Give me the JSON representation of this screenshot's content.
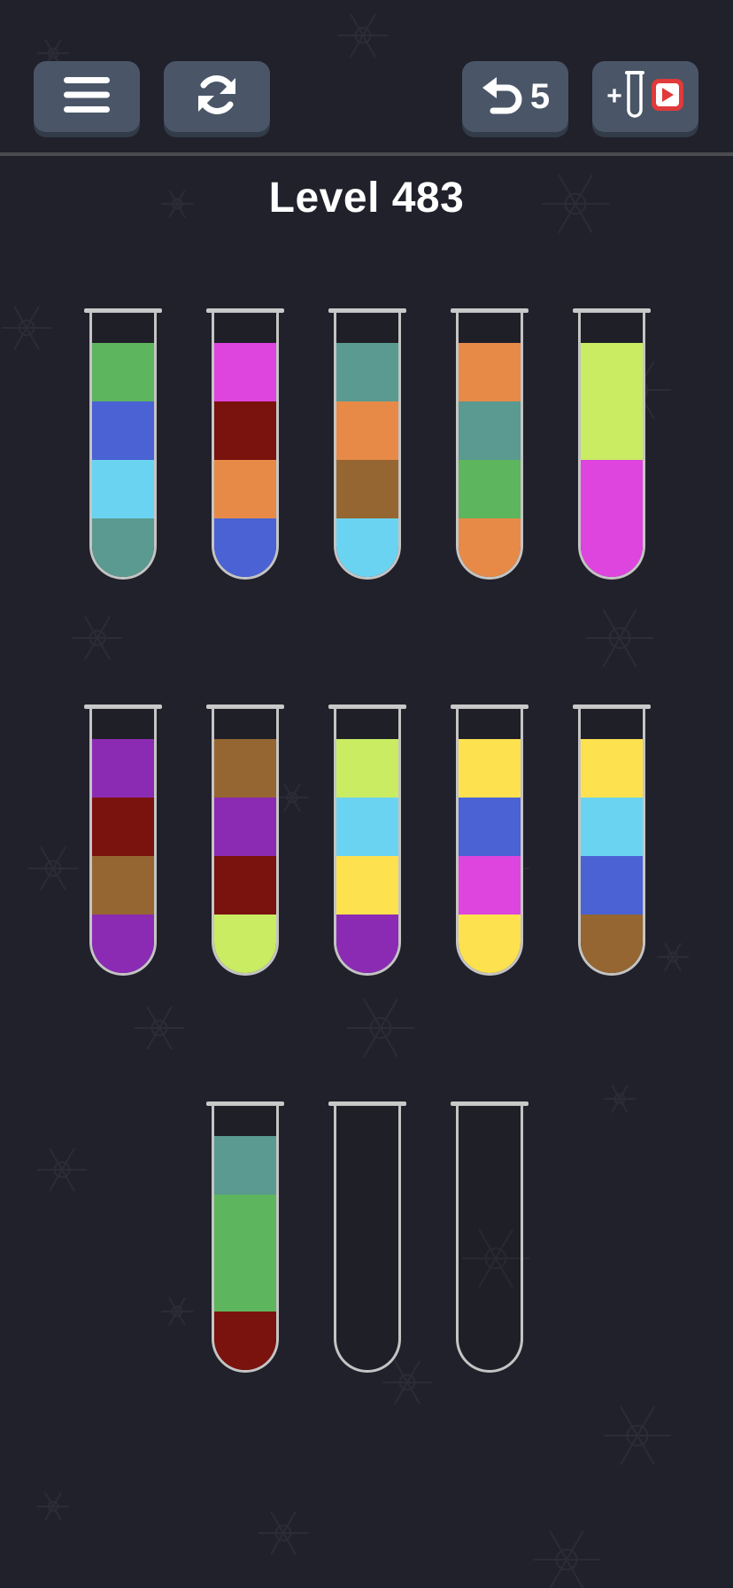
{
  "header": {
    "menu_icon": "hamburger-menu-icon",
    "restart_icon": "restart-arrows-icon",
    "undo_icon": "undo-arrow-icon",
    "undo_count": "5",
    "add_tube_plus": "+",
    "add_tube_icon": "test-tube-icon",
    "video_icon": "video-ad-play-icon"
  },
  "level": {
    "title": "Level 483"
  },
  "colors": {
    "green": "#5db55e",
    "blue": "#4a62d4",
    "light_blue": "#6bd3f2",
    "teal": "#5a9a90",
    "magenta": "#dd45de",
    "dark_red": "#7a120d",
    "orange": "#e78a48",
    "brown": "#956632",
    "lime": "#c9ec63",
    "purple": "#8b2bb3",
    "yellow": "#fde14f"
  },
  "tubes": [
    {
      "id": 1,
      "capacity": 4,
      "layers_bottom_to_top": [
        "teal",
        "light_blue",
        "blue",
        "green"
      ]
    },
    {
      "id": 2,
      "capacity": 4,
      "layers_bottom_to_top": [
        "blue",
        "orange",
        "dark_red",
        "magenta"
      ]
    },
    {
      "id": 3,
      "capacity": 4,
      "layers_bottom_to_top": [
        "light_blue",
        "brown",
        "orange",
        "teal"
      ]
    },
    {
      "id": 4,
      "capacity": 4,
      "layers_bottom_to_top": [
        "orange",
        "green",
        "teal",
        "orange"
      ]
    },
    {
      "id": 5,
      "capacity": 4,
      "layers_bottom_to_top": [
        "magenta",
        "magenta",
        "lime",
        "lime"
      ]
    },
    {
      "id": 6,
      "capacity": 4,
      "layers_bottom_to_top": [
        "purple",
        "brown",
        "dark_red",
        "purple"
      ]
    },
    {
      "id": 7,
      "capacity": 4,
      "layers_bottom_to_top": [
        "lime",
        "dark_red",
        "purple",
        "brown"
      ]
    },
    {
      "id": 8,
      "capacity": 4,
      "layers_bottom_to_top": [
        "purple",
        "yellow",
        "light_blue",
        "lime"
      ]
    },
    {
      "id": 9,
      "capacity": 4,
      "layers_bottom_to_top": [
        "yellow",
        "magenta",
        "blue",
        "yellow"
      ]
    },
    {
      "id": 10,
      "capacity": 4,
      "layers_bottom_to_top": [
        "brown",
        "blue",
        "light_blue",
        "yellow"
      ]
    },
    {
      "id": 11,
      "capacity": 4,
      "layers_bottom_to_top": [
        "dark_red",
        "green",
        "green",
        "teal"
      ]
    },
    {
      "id": 12,
      "capacity": 4,
      "layers_bottom_to_top": []
    },
    {
      "id": 13,
      "capacity": 4,
      "layers_bottom_to_top": []
    }
  ]
}
